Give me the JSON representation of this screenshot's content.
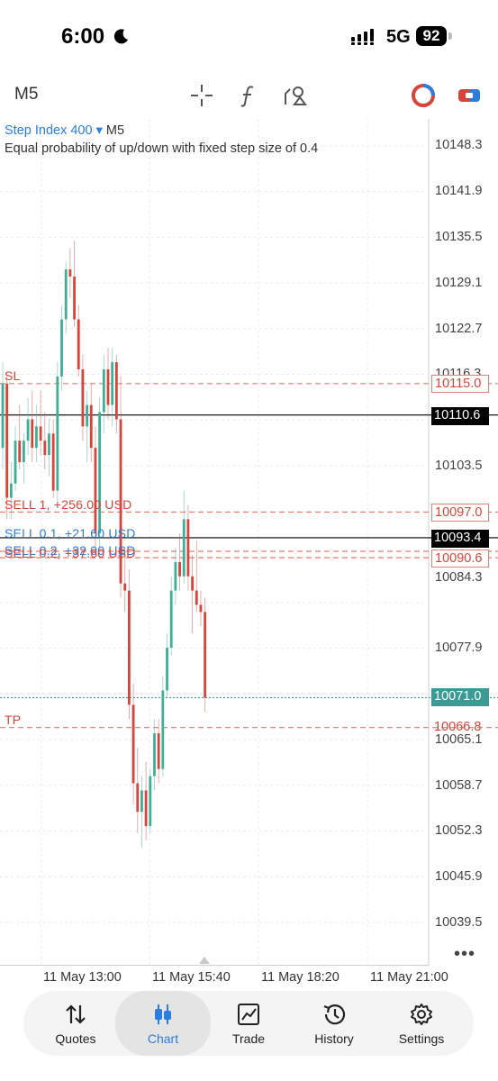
{
  "status": {
    "time": "6:00",
    "network": "5G",
    "battery": "92"
  },
  "toolbar": {
    "timeframe": "M5"
  },
  "chart_header": {
    "symbol": "Step Index 400",
    "dropdown": "▾",
    "timeframe": "M5",
    "description": "Equal probability of up/down with fixed step size of 0.4"
  },
  "price_axis": [
    "10148.3",
    "10141.9",
    "10135.5",
    "10129.1",
    "10122.7",
    "10116.3",
    "10103.5",
    "10084.3",
    "10077.9",
    "10065.1",
    "10058.7",
    "10052.3",
    "10045.9",
    "10039.5"
  ],
  "price_boxes": {
    "sl": "10115.0",
    "current_black": "10110.6",
    "sell1": "10097.0",
    "ask": "10093.4",
    "sell02": "10090.6",
    "bid": "10071.0",
    "tp": "10066.8"
  },
  "line_labels": {
    "sl": "SL",
    "tp": "TP",
    "sell1": "SELL 1, +256.00 USD",
    "sell01": "SELL 0.1, +21.60 USD",
    "sell_overlap_a": "SELL 0.2, +32.00 USD",
    "sell_overlap_b": "SELL 0.2, +37.60 USD"
  },
  "time_axis": [
    "11 May 13:00",
    "11 May 15:40",
    "11 May 18:20",
    "11 May 21:00"
  ],
  "more": "•••",
  "tabs": [
    {
      "label": "Quotes",
      "icon": "quotes-icon"
    },
    {
      "label": "Chart",
      "icon": "chart-candles-icon"
    },
    {
      "label": "Trade",
      "icon": "trade-icon"
    },
    {
      "label": "History",
      "icon": "history-icon"
    },
    {
      "label": "Settings",
      "icon": "settings-icon"
    }
  ],
  "colors": {
    "bull": "#3fae94",
    "bear": "#d9443a",
    "accent": "#2a7de1",
    "teal_line": "#3a9b94"
  },
  "chart_data": {
    "type": "candlestick",
    "symbol": "Step Index 400",
    "timeframe": "M5",
    "ylim": [
      10036.0,
      10152.0
    ],
    "x_ticks": [
      "11 May 13:00",
      "11 May 15:40",
      "11 May 18:20",
      "11 May 21:00"
    ],
    "horizontal_lines": [
      {
        "label": "SL",
        "value": 10115.0,
        "style": "dashed",
        "color": "#e87d76"
      },
      {
        "label": "",
        "value": 10110.6,
        "style": "solid",
        "color": "#000000"
      },
      {
        "label": "SELL 1, +256.00 USD",
        "value": 10097.0,
        "style": "dashed",
        "color": "#e87d76"
      },
      {
        "label": "",
        "value": 10093.4,
        "style": "solid",
        "color": "#000000"
      },
      {
        "label": "SELL 0.1, +21.60 USD",
        "value": 10091.5,
        "style": "dashed",
        "color": "#e87d76"
      },
      {
        "label": "SELL 0.2",
        "value": 10090.6,
        "style": "dashed",
        "color": "#e87d76"
      },
      {
        "label": "",
        "value": 10071.0,
        "style": "dotted",
        "color": "#3a9b94"
      },
      {
        "label": "TP",
        "value": 10066.8,
        "style": "dashed",
        "color": "#e87d76"
      }
    ],
    "candles": [
      {
        "o": 10106,
        "h": 10118,
        "l": 10103,
        "c": 10115
      },
      {
        "o": 10115,
        "h": 10116,
        "l": 10096,
        "c": 10099
      },
      {
        "o": 10099,
        "h": 10104,
        "l": 10096,
        "c": 10101
      },
      {
        "o": 10101,
        "h": 10109,
        "l": 10100,
        "c": 10107
      },
      {
        "o": 10107,
        "h": 10112,
        "l": 10103,
        "c": 10104
      },
      {
        "o": 10104,
        "h": 10108,
        "l": 10101,
        "c": 10107
      },
      {
        "o": 10107,
        "h": 10113,
        "l": 10105,
        "c": 10110
      },
      {
        "o": 10110,
        "h": 10114,
        "l": 10104,
        "c": 10106
      },
      {
        "o": 10106,
        "h": 10112,
        "l": 10104,
        "c": 10109
      },
      {
        "o": 10109,
        "h": 10114,
        "l": 10105,
        "c": 10107
      },
      {
        "o": 10107,
        "h": 10111,
        "l": 10103,
        "c": 10105
      },
      {
        "o": 10105,
        "h": 10110,
        "l": 10102,
        "c": 10108
      },
      {
        "o": 10108,
        "h": 10110,
        "l": 10099,
        "c": 10100
      },
      {
        "o": 10100,
        "h": 10118,
        "l": 10098,
        "c": 10116
      },
      {
        "o": 10116,
        "h": 10126,
        "l": 10114,
        "c": 10124
      },
      {
        "o": 10124,
        "h": 10132,
        "l": 10122,
        "c": 10131
      },
      {
        "o": 10131,
        "h": 10134,
        "l": 10127,
        "c": 10130
      },
      {
        "o": 10130,
        "h": 10135,
        "l": 10123,
        "c": 10124
      },
      {
        "o": 10124,
        "h": 10126,
        "l": 10116,
        "c": 10117
      },
      {
        "o": 10117,
        "h": 10119,
        "l": 10107,
        "c": 10109
      },
      {
        "o": 10109,
        "h": 10114,
        "l": 10104,
        "c": 10112
      },
      {
        "o": 10112,
        "h": 10115,
        "l": 10104,
        "c": 10106
      },
      {
        "o": 10106,
        "h": 10109,
        "l": 10091,
        "c": 10094
      },
      {
        "o": 10094,
        "h": 10113,
        "l": 10092,
        "c": 10111
      },
      {
        "o": 10111,
        "h": 10119,
        "l": 10108,
        "c": 10117
      },
      {
        "o": 10117,
        "h": 10120,
        "l": 10110,
        "c": 10112
      },
      {
        "o": 10112,
        "h": 10120,
        "l": 10109,
        "c": 10118
      },
      {
        "o": 10118,
        "h": 10119,
        "l": 10108,
        "c": 10110
      },
      {
        "o": 10110,
        "h": 10116,
        "l": 10085,
        "c": 10087
      },
      {
        "o": 10087,
        "h": 10092,
        "l": 10083,
        "c": 10086
      },
      {
        "o": 10086,
        "h": 10089,
        "l": 10068,
        "c": 10070
      },
      {
        "o": 10070,
        "h": 10073,
        "l": 10056,
        "c": 10059
      },
      {
        "o": 10059,
        "h": 10064,
        "l": 10052,
        "c": 10055
      },
      {
        "o": 10055,
        "h": 10060,
        "l": 10050,
        "c": 10058
      },
      {
        "o": 10058,
        "h": 10062,
        "l": 10051,
        "c": 10053
      },
      {
        "o": 10053,
        "h": 10061,
        "l": 10052,
        "c": 10060
      },
      {
        "o": 10060,
        "h": 10068,
        "l": 10058,
        "c": 10066
      },
      {
        "o": 10066,
        "h": 10068,
        "l": 10059,
        "c": 10061
      },
      {
        "o": 10061,
        "h": 10074,
        "l": 10060,
        "c": 10072
      },
      {
        "o": 10072,
        "h": 10080,
        "l": 10071,
        "c": 10078
      },
      {
        "o": 10078,
        "h": 10088,
        "l": 10077,
        "c": 10086
      },
      {
        "o": 10086,
        "h": 10092,
        "l": 10084,
        "c": 10090
      },
      {
        "o": 10090,
        "h": 10094,
        "l": 10086,
        "c": 10088
      },
      {
        "o": 10088,
        "h": 10100,
        "l": 10087,
        "c": 10096
      },
      {
        "o": 10096,
        "h": 10098,
        "l": 10086,
        "c": 10088
      },
      {
        "o": 10088,
        "h": 10091,
        "l": 10080,
        "c": 10086
      },
      {
        "o": 10086,
        "h": 10093,
        "l": 10083,
        "c": 10084
      },
      {
        "o": 10084,
        "h": 10086,
        "l": 10081,
        "c": 10083
      },
      {
        "o": 10083,
        "h": 10085,
        "l": 10069,
        "c": 10071
      }
    ]
  }
}
